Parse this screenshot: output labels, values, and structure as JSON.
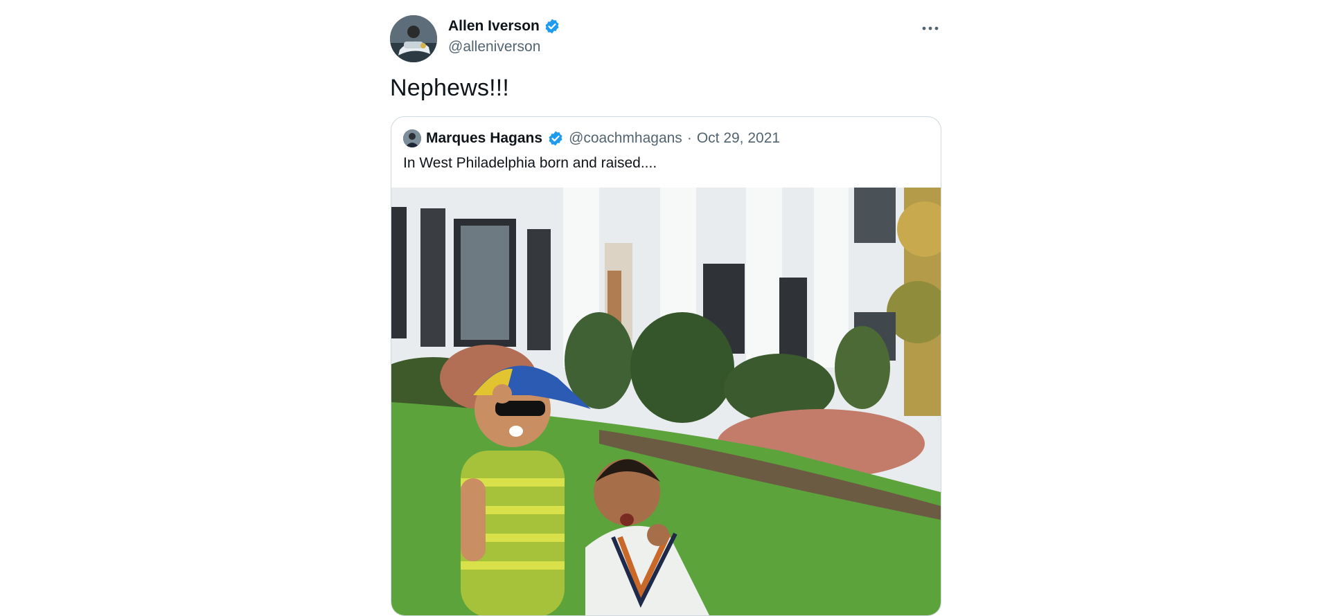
{
  "tweet": {
    "author": {
      "display_name": "Allen Iverson",
      "handle": "@alleniverson",
      "verified": true,
      "avatar_icon": "profile-photo"
    },
    "more_icon": "ellipsis-icon",
    "text": "Nephews!!!",
    "quoted": {
      "display_name": "Marques Hagans",
      "handle": "@coachmhagans",
      "separator": "·",
      "date": "Oct 29, 2021",
      "verified": true,
      "text": "In West Philadelphia born and raised....",
      "media_description_icon": "photo-two-boys-in-front-of-white-house"
    }
  },
  "colors": {
    "verified_blue": "#1d9bf0",
    "secondary_text": "#536471",
    "border": "#cfd9de"
  }
}
